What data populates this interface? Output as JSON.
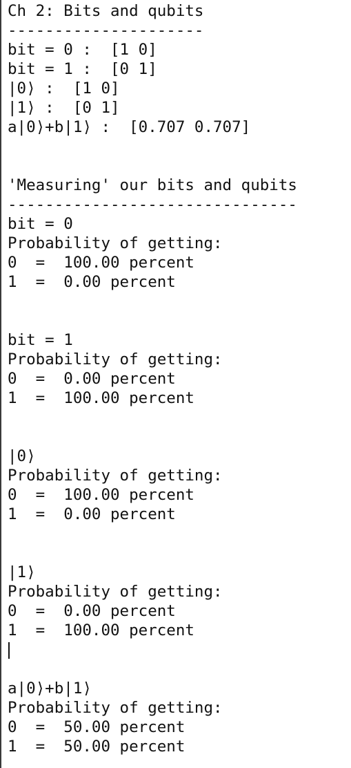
{
  "console": {
    "lines": [
      "Ch 2: Bits and qubits",
      "---------------------",
      "bit = 0 :  [1 0]",
      "bit = 1 :  [0 1]",
      "|0⟩ :  [1 0]",
      "|1⟩ :  [0 1]",
      "a|0⟩+b|1⟩ :  [0.707 0.707]",
      "",
      "",
      "'Measuring' our bits and qubits",
      "-------------------------------",
      "bit = 0",
      "Probability of getting:",
      "0  =  100.00 percent",
      "1  =  0.00 percent",
      "",
      "",
      "bit = 1",
      "Probability of getting:",
      "0  =  0.00 percent",
      "1  =  100.00 percent",
      "",
      "",
      "|0⟩",
      "Probability of getting:",
      "0  =  100.00 percent",
      "1  =  0.00 percent",
      "",
      "",
      "|1⟩",
      "Probability of getting:",
      "0  =  0.00 percent",
      "1  =  100.00 percent",
      "",
      "",
      "a|0⟩+b|1⟩",
      "Probability of getting:",
      "0  =  50.00 percent",
      "1  =  50.00 percent"
    ],
    "cursor_line_index": 33
  }
}
